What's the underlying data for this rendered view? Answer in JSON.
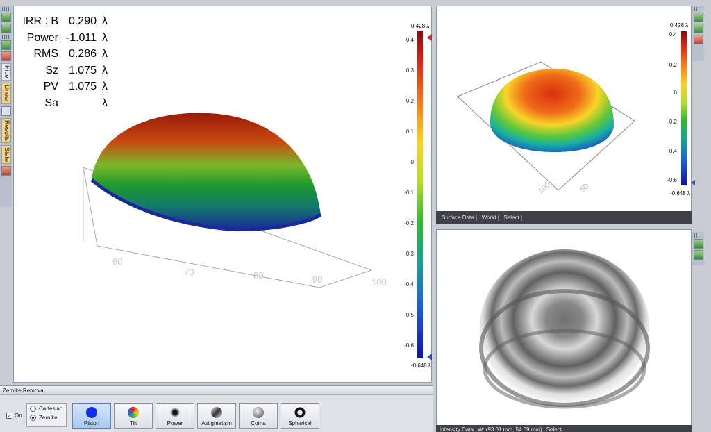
{
  "left_toolbar": {
    "tabs": [
      "Hide",
      "Linear",
      "Results",
      "State"
    ]
  },
  "main_plot": {
    "stats": [
      {
        "label": "IRR : B",
        "value": "0.290",
        "unit": "λ"
      },
      {
        "label": "Power",
        "value": "-1.011",
        "unit": "λ"
      },
      {
        "label": "RMS",
        "value": "0.286",
        "unit": "λ"
      },
      {
        "label": "Sz",
        "value": "1.075",
        "unit": "λ"
      },
      {
        "label": "PV",
        "value": "1.075",
        "unit": "λ"
      },
      {
        "label": "Sa",
        "value": "",
        "unit": "λ"
      }
    ],
    "axis_ticks": [
      "60",
      "70",
      "80",
      "90",
      "100"
    ],
    "colorbar": {
      "max": "0.428 λ",
      "min": "-0.648 λ",
      "ticks": [
        "0.4",
        "0.3",
        "0.2",
        "0.1",
        "0",
        "-0.1",
        "-0.2",
        "-0.3",
        "-0.4",
        "-0.5",
        "-0.6"
      ]
    }
  },
  "top_right_plot": {
    "axis_ticks": [
      "100",
      "50"
    ],
    "colorbar": {
      "max": "0.428 λ",
      "min": "-0.648 λ",
      "ticks": [
        "0.4",
        "0.2",
        "0",
        "-0.2",
        "-0.4",
        "-0.6"
      ]
    },
    "status_bar": [
      "Surface Data",
      "World",
      "Select"
    ]
  },
  "bottom_right_plot": {
    "status_bar": [
      "Intensity Data",
      "W: (93.01 mm, 54.09 mm)",
      "Select"
    ]
  },
  "zernike": {
    "title": "Zernike Removal",
    "on_label": "On",
    "on_checked": true,
    "modes": [
      "Cartesian",
      "Zernike"
    ],
    "selected_mode": "Zernike",
    "buttons": [
      {
        "label": "Piston",
        "selected": true
      },
      {
        "label": "Tilt",
        "selected": false
      },
      {
        "label": "Power",
        "selected": false
      },
      {
        "label": "Astigmatism",
        "selected": false
      },
      {
        "label": "Coma",
        "selected": false
      },
      {
        "label": "Spherical",
        "selected": false
      }
    ]
  },
  "colors": {
    "accent_selected": "#a9c8f0",
    "status_bar_bg": "#3e4146",
    "piston_icon": "#1030e8"
  }
}
